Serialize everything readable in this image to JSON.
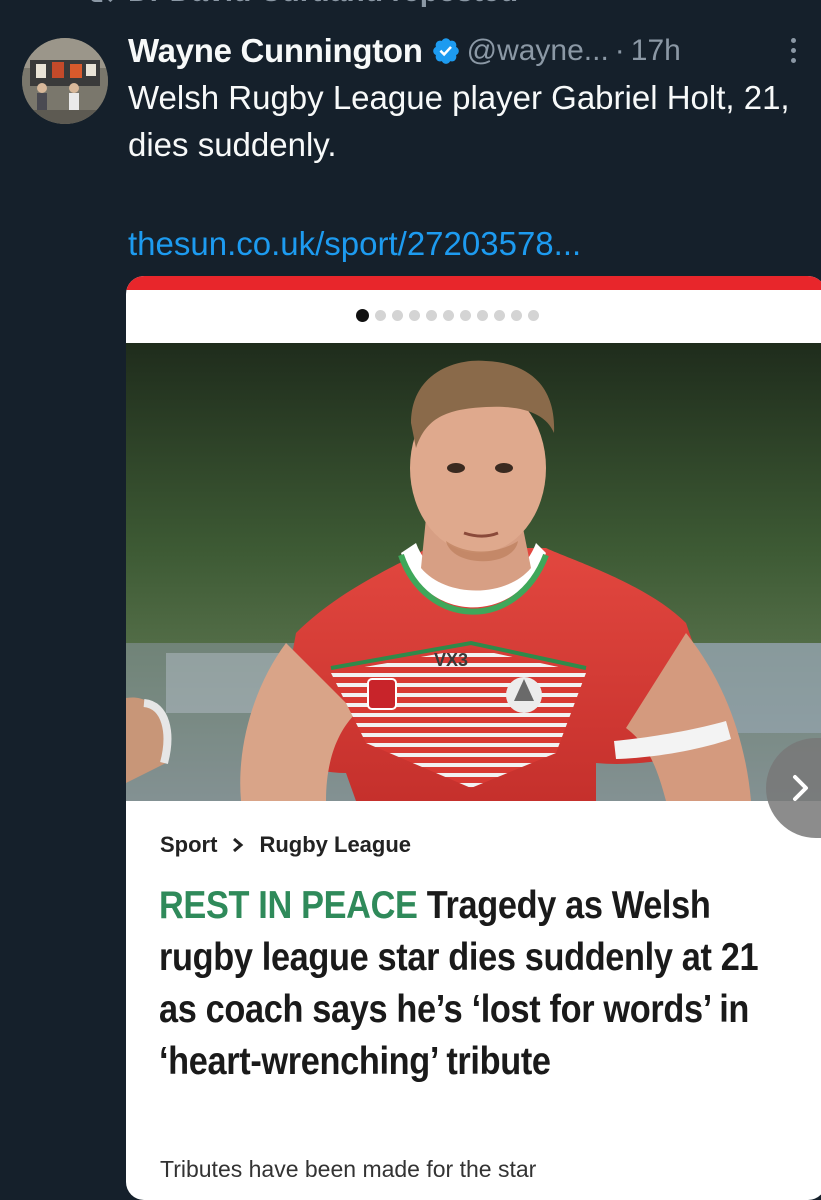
{
  "repost": {
    "text": "Dr David Curtland reposted",
    "icon": "repost-icon"
  },
  "tweet": {
    "author_name": "Wayne Cunnington",
    "handle": "@wayne...",
    "separator": "·",
    "time": "17h",
    "text": "Welsh Rugby League player Gabriel Holt, 21, dies suddenly.",
    "link": "thesun.co.uk/sport/27203578..."
  },
  "card": {
    "carousel_dots": 11,
    "active_dot": 0,
    "breadcrumb": [
      "Sport",
      "Rugby League"
    ],
    "headline_kicker": "REST IN PEACE",
    "headline": "Tragedy as Welsh rugby league star dies suddenly at 21 as coach says he’s ‘lost for words’ in ‘heart-wrenching’ tribute",
    "subtitle": "Tributes have been made for the star",
    "shirt_brand": "VX3"
  },
  "colors": {
    "background": "#15202b",
    "link": "#1d9bf0",
    "verified": "#1d9bf0",
    "muted": "#8b98a5",
    "sun_red": "#e8262b",
    "kicker_green": "#2f8a5a"
  }
}
